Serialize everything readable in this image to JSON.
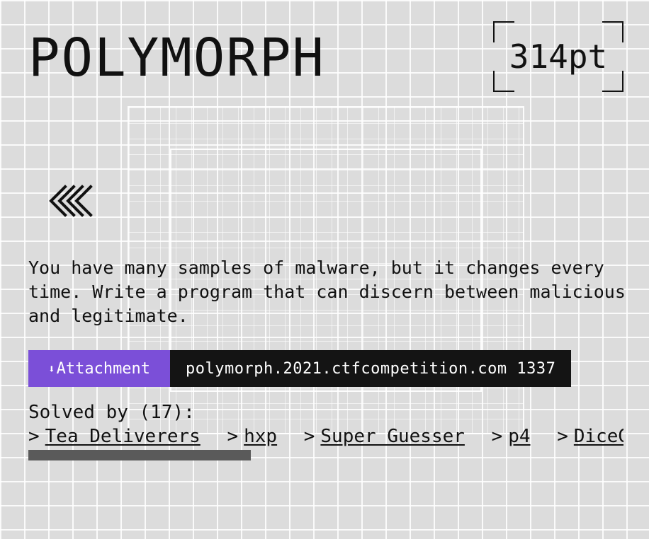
{
  "challenge": {
    "title": "POLYMORPH",
    "points": "314pt",
    "description": "You have many samples of malware, but it changes every time. Write a program that can discern between malicious and legitimate."
  },
  "actions": {
    "attachment_icon": "download-arrow-icon",
    "attachment_label": "Attachment",
    "host": "polymorph.2021.ctfcompetition.com 1337"
  },
  "solved": {
    "label": "Solved by (17):",
    "prefix": ">",
    "teams": [
      "Tea Deliverers",
      "hxp",
      "Super Guesser",
      "p4",
      "DiceGang"
    ]
  },
  "colors": {
    "accent": "#7b4fd8",
    "host_bg": "#141414",
    "scrollbar": "#5a5a5a"
  }
}
